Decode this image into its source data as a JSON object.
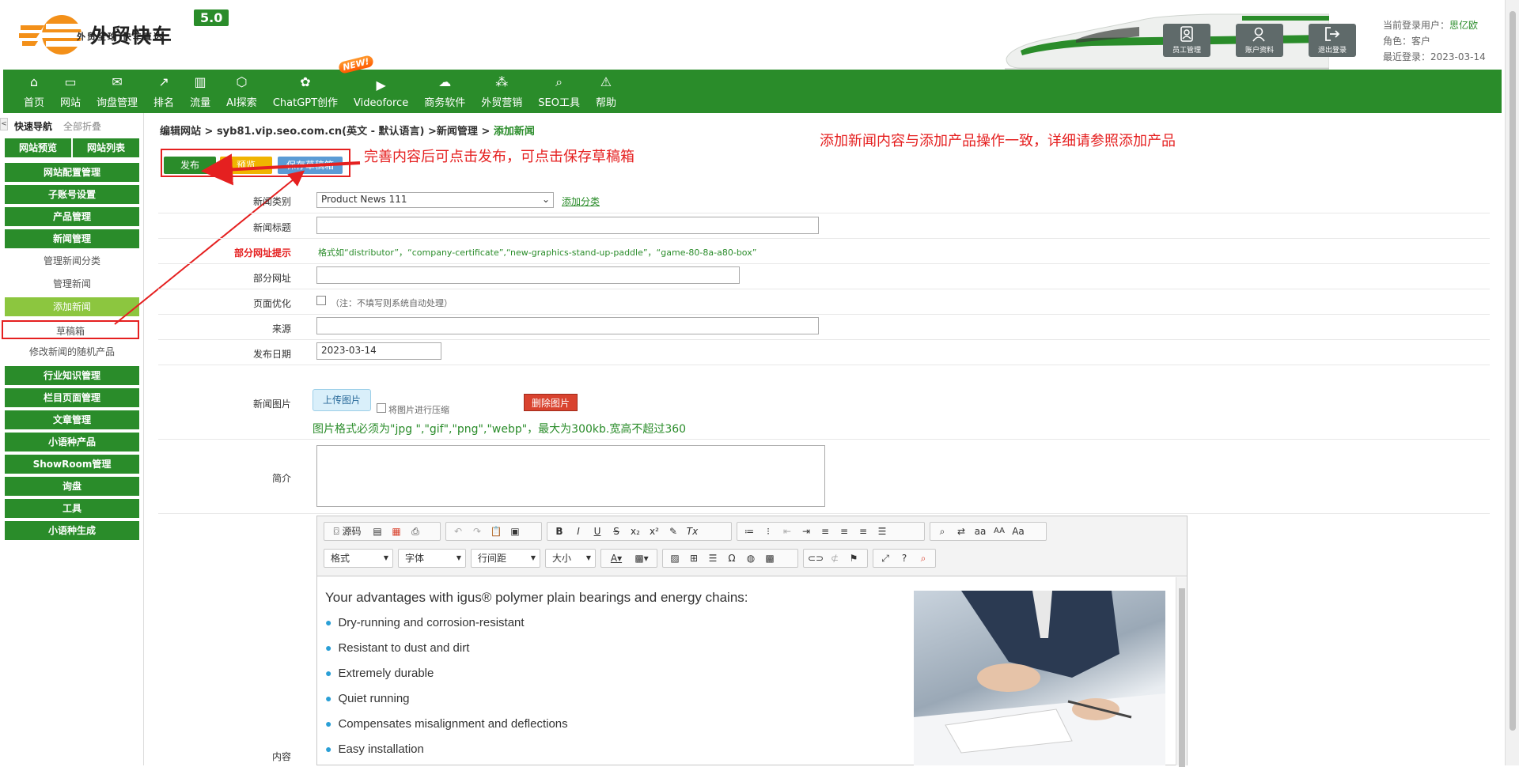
{
  "header": {
    "logo_title": "外贸快车",
    "logo_version": "5.0",
    "logo_subtitle": "外贸全球 快车直达",
    "buttons": [
      "员工管理",
      "账户资料",
      "退出登录"
    ],
    "user_label": "当前登录用户：",
    "user_name": "思亿欧",
    "role_label": "角色：客户",
    "last_login": "最近登录：2023-03-14"
  },
  "nav": {
    "items": [
      {
        "label": "首页",
        "icon": "home-icon"
      },
      {
        "label": "网站",
        "icon": "monitor-icon"
      },
      {
        "label": "询盘管理",
        "icon": "mail-icon"
      },
      {
        "label": "排名",
        "icon": "rank-icon"
      },
      {
        "label": "流量",
        "icon": "bar-chart-icon"
      },
      {
        "label": "AI探索",
        "icon": "ai-icon"
      },
      {
        "label": "ChatGPT创作",
        "icon": "chatgpt-icon"
      },
      {
        "label": "Videoforce",
        "icon": "video-icon"
      },
      {
        "label": "商务软件",
        "icon": "software-icon"
      },
      {
        "label": "外贸营销",
        "icon": "marketing-icon"
      },
      {
        "label": "SEO工具",
        "icon": "search-icon"
      },
      {
        "label": "帮助",
        "icon": "help-icon"
      }
    ],
    "new_badge": "NEW!"
  },
  "sidebar": {
    "quick_nav": "快速导航",
    "collapse_all": "全部折叠",
    "collapse_arrow": "<",
    "top_left": "网站预览",
    "top_right": "网站列表",
    "items": [
      {
        "label": "网站配置管理",
        "kind": "group"
      },
      {
        "label": "子账号设置",
        "kind": "group"
      },
      {
        "label": "产品管理",
        "kind": "group"
      },
      {
        "label": "新闻管理",
        "kind": "group"
      },
      {
        "label": "管理新闻分类",
        "kind": "sub"
      },
      {
        "label": "管理新闻",
        "kind": "sub"
      },
      {
        "label": "添加新闻",
        "kind": "active"
      },
      {
        "label": "草稿箱",
        "kind": "sub"
      },
      {
        "label": "修改新闻的随机产品",
        "kind": "sub"
      },
      {
        "label": "行业知识管理",
        "kind": "group"
      },
      {
        "label": "栏目页面管理",
        "kind": "group"
      },
      {
        "label": "文章管理",
        "kind": "group"
      },
      {
        "label": "小语种产品",
        "kind": "group"
      },
      {
        "label": "ShowRoom管理",
        "kind": "group"
      },
      {
        "label": "询盘",
        "kind": "group"
      },
      {
        "label": "工具",
        "kind": "group"
      },
      {
        "label": "小语种生成",
        "kind": "group"
      }
    ]
  },
  "breadcrumb": {
    "path": "编辑网站 > syb81.vip.seo.com.cn(英文 - 默认语言) >新闻管理 > ",
    "current": "添加新闻"
  },
  "annotations": {
    "publish_tip": "完善内容后可点击发布，可点击保存草稿箱",
    "top_tip": "添加新闻内容与添加产品操作一致，详细请参照添加产品"
  },
  "actions": {
    "publish": "发布",
    "preview": "预览",
    "save_draft": "保存草稿箱"
  },
  "form": {
    "category_label": "新闻类别",
    "category_value": "Product News 111",
    "add_category_link": "添加分类",
    "title_label": "新闻标题",
    "title_value": "",
    "url_tip_label": "部分网址提示",
    "url_tip_text": "格式如“distributor”，“company-certificate”,“new-graphics-stand-up-paddle”，“game-80-8a-a80-box”",
    "url_label": "部分网址",
    "url_value": "",
    "seo_label": "页面优化",
    "seo_note": "（注：不填写则系统自动处理）",
    "source_label": "来源",
    "source_value": "",
    "date_label": "发布日期",
    "date_value": "2023-03-14",
    "image_label": "新闻图片",
    "upload_button": "上传图片",
    "compress_label": "将图片进行压缩",
    "delete_image": "删除图片",
    "image_rule": "图片格式必须为\"jpg \",\"gif\",\"png\",\"webp\"，最大为300kb.宽高不超过360",
    "summary_label": "简介",
    "summary_value": "",
    "content_label": "内容"
  },
  "editor": {
    "source_btn": "源码",
    "combos": [
      "格式",
      "字体",
      "行间距",
      "大小"
    ],
    "heading": "Your advantages with igus® polymer plain bearings and energy chains:",
    "bullets": [
      "Dry-running and corrosion-resistant",
      "Resistant to dust and dirt",
      "Extremely durable",
      "Quiet running",
      "Compensates misalignment and deflections",
      "Easy installation"
    ]
  },
  "colors": {
    "brand_green": "#2a8c2a",
    "active_green": "#8cc63f",
    "annotation_red": "#e52020"
  }
}
